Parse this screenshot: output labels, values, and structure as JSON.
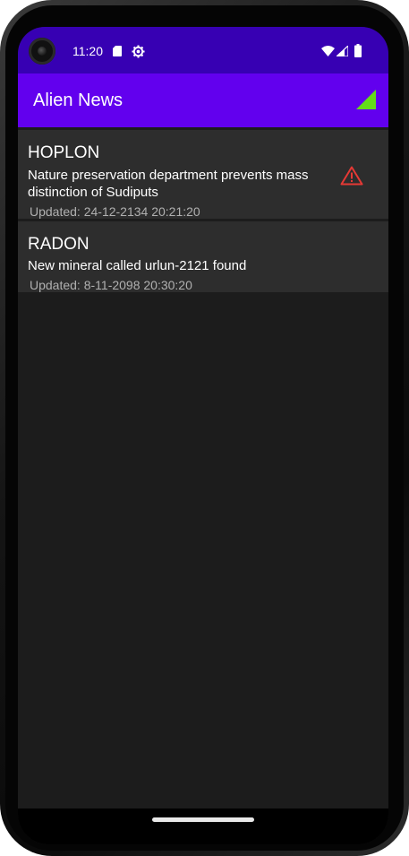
{
  "status_bar": {
    "time": "11:20",
    "icons": [
      "sd-card-icon",
      "gear-icon",
      "wifi-icon",
      "signal-icon",
      "battery-icon"
    ]
  },
  "app_bar": {
    "title": "Alien News",
    "action_icon": "signal-strength-icon",
    "colors": {
      "app_bar": "#6200ee",
      "status_bar": "#3700b3",
      "action_icon": "#64dd17"
    }
  },
  "news": [
    {
      "title": "HOPLON",
      "body": "Nature preservation department prevents mass distinction of Sudiputs",
      "updated": "Updated: 24-12-2134 20:21:20",
      "warning": true,
      "warning_icon": "warning-triangle-icon",
      "warning_color": "#e53935"
    },
    {
      "title": "RADON",
      "body": "New mineral called urlun-2121 found",
      "updated": "Updated: 8-11-2098 20:30:20",
      "warning": false
    }
  ],
  "nav": {
    "handle": "home-gesture-handle"
  }
}
